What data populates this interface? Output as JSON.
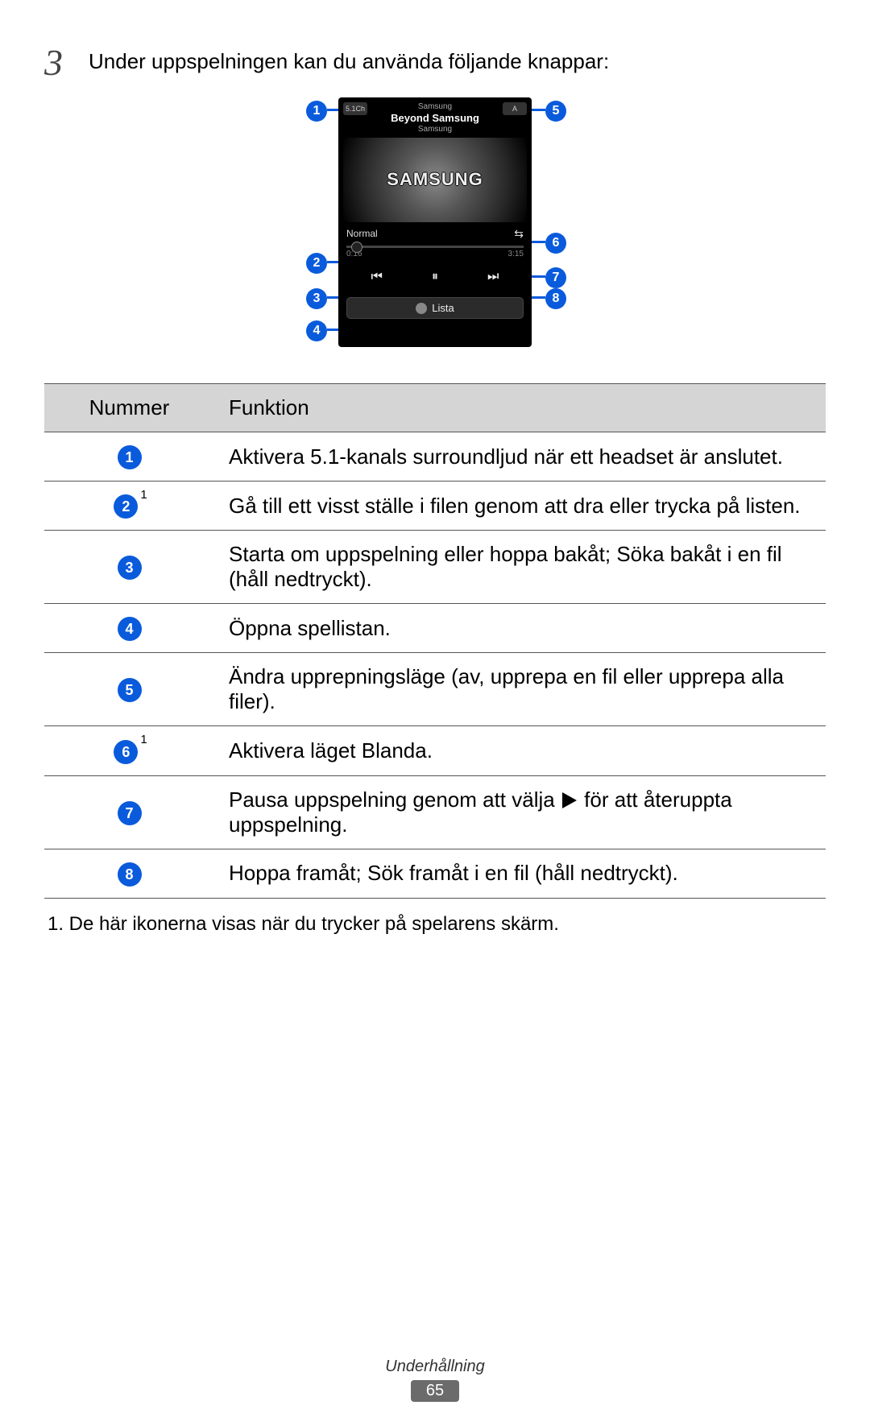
{
  "step": {
    "number": "3",
    "text": "Under uppspelningen kan du använda följande knappar:"
  },
  "figure": {
    "phone": {
      "badge51": "5.1Ch",
      "badgeA": "A",
      "topSub": "Samsung",
      "topTitle": "Beyond Samsung",
      "topSub2": "Samsung",
      "albumBrand": "SAMSUNG",
      "normalLabel": "Normal",
      "shuffleIcon": "⇆",
      "time0": "0:16",
      "time1": "3:15",
      "prevIcon": "⏮",
      "pauseIcon": "⏸",
      "nextIcon": "⏭",
      "listaLabel": "Lista"
    },
    "bubbles": {
      "b1": "1",
      "b2": "2",
      "b3": "3",
      "b4": "4",
      "b5": "5",
      "b6": "6",
      "b7": "7",
      "b8": "8"
    }
  },
  "table": {
    "headNum": "Nummer",
    "headFn": "Funktion",
    "rows": [
      {
        "n": "1",
        "sup": "",
        "fn": "Aktivera 5.1-kanals surroundljud när ett headset är anslutet."
      },
      {
        "n": "2",
        "sup": "1",
        "fn": "Gå till ett visst ställe i filen genom att dra eller trycka på listen."
      },
      {
        "n": "3",
        "sup": "",
        "fn": "Starta om uppspelning eller hoppa bakåt; Söka bakåt i en fil (håll nedtryckt)."
      },
      {
        "n": "4",
        "sup": "",
        "fn": "Öppna spellistan."
      },
      {
        "n": "5",
        "sup": "",
        "fn": "Ändra upprepningsläge (av, upprepa en fil eller upprepa alla filer)."
      },
      {
        "n": "6",
        "sup": "1",
        "fn": "Aktivera läget Blanda."
      },
      {
        "n": "7",
        "sup": "",
        "fn_pre": "Pausa uppspelning genom att välja ",
        "fn_post": " för att återuppta uppspelning."
      },
      {
        "n": "8",
        "sup": "",
        "fn": "Hoppa framåt; Sök framåt i en fil (håll nedtryckt)."
      }
    ]
  },
  "footnote": "1.  De här ikonerna visas när du trycker på spelarens skärm.",
  "footer": {
    "section": "Underhållning",
    "page": "65"
  }
}
